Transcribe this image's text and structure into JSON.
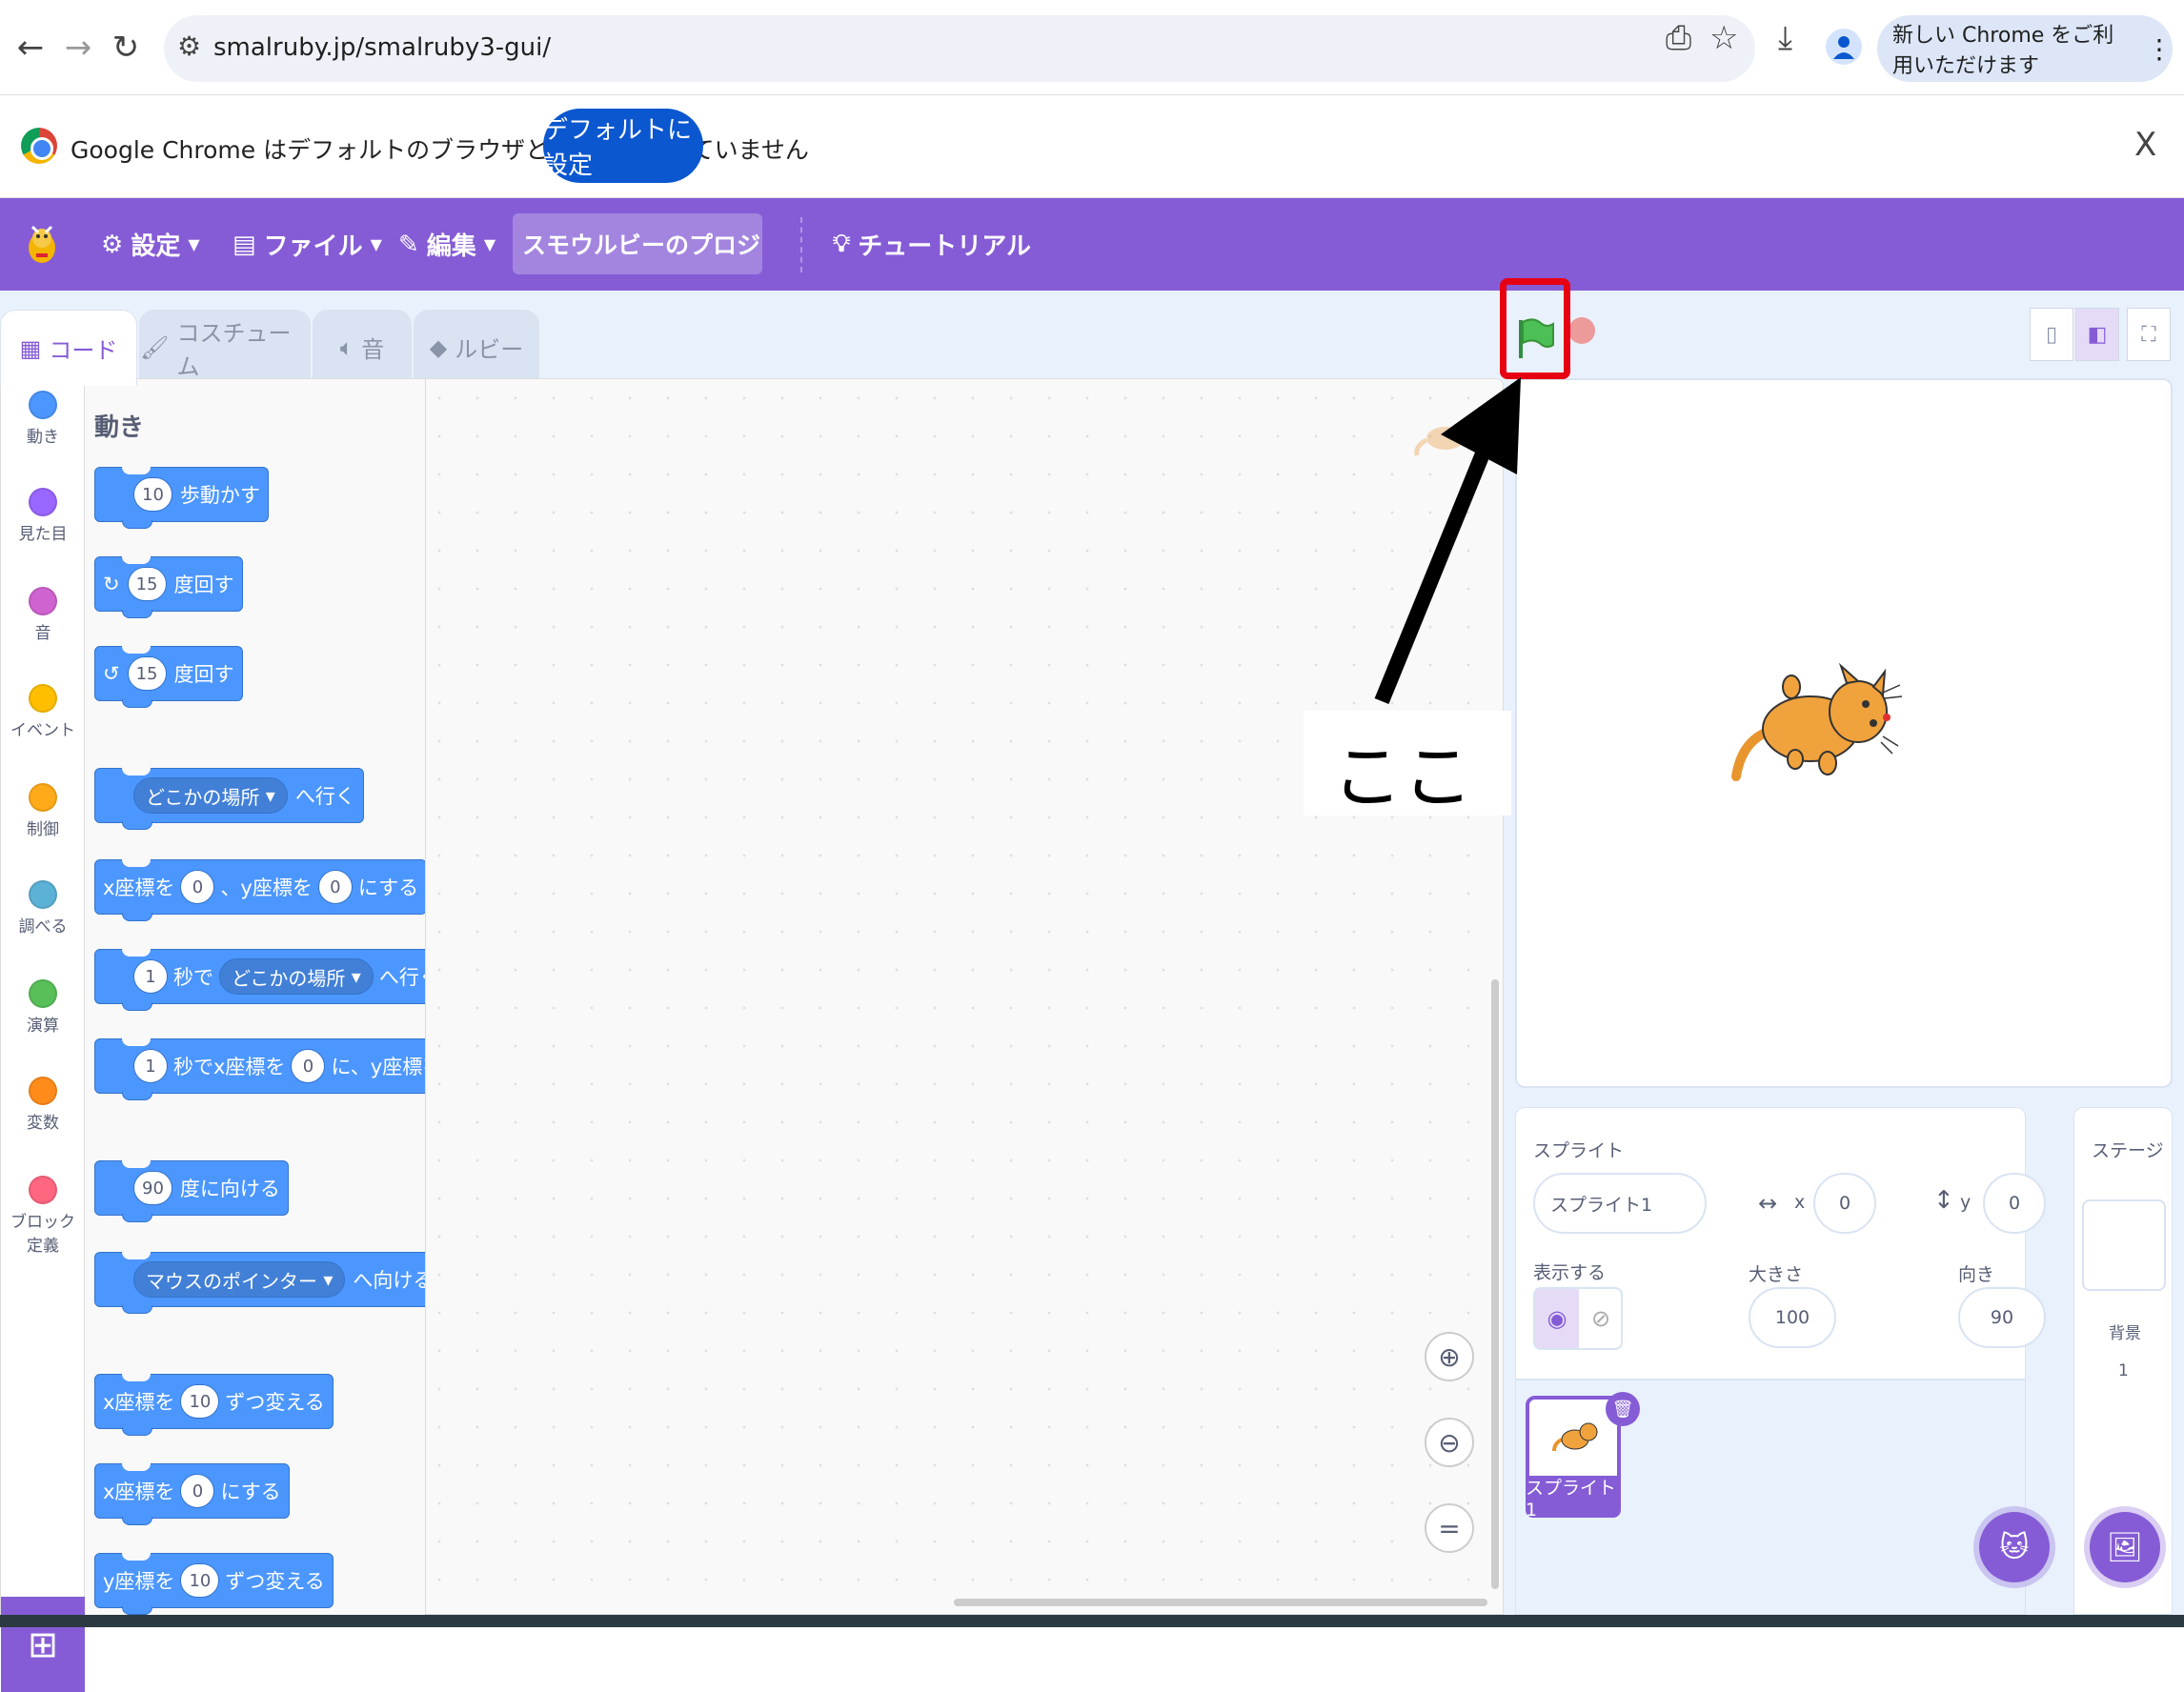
{
  "browser": {
    "url": "smalruby.jp/smalruby3-gui/",
    "new_chrome_text": "新しい Chrome をご利用いただけます",
    "infobar_message": "Google Chrome はデフォルトのブラウザとして設定されていません",
    "infobar_button": "デフォルトに設定",
    "infobar_close": "X"
  },
  "menubar": {
    "settings": "設定",
    "file": "ファイル",
    "edit": "編集",
    "project_title": "スモウルビーのプロジェ...",
    "tutorial": "チュートリアル"
  },
  "tabs": {
    "code": "コード",
    "costume": "コスチューム",
    "sound": "音",
    "ruby": "ルビー"
  },
  "categories": [
    {
      "label": "動き",
      "color": "#4c97ff"
    },
    {
      "label": "見た目",
      "color": "#9966ff"
    },
    {
      "label": "音",
      "color": "#cf63cf"
    },
    {
      "label": "イベント",
      "color": "#ffbf00"
    },
    {
      "label": "制御",
      "color": "#ffab19"
    },
    {
      "label": "調べる",
      "color": "#5cb1d6"
    },
    {
      "label": "演算",
      "color": "#59c059"
    },
    {
      "label": "変数",
      "color": "#ff8c1a"
    },
    {
      "label": "ブロック定義",
      "color": "#ff6680"
    }
  ],
  "flyout": {
    "title": "動き",
    "blocks": {
      "move": {
        "num": "10",
        "text": "歩動かす"
      },
      "turn_right": {
        "num": "15",
        "text": "度回す"
      },
      "turn_left": {
        "num": "15",
        "text": "度回す"
      },
      "goto": {
        "drop": "どこかの場所",
        "text": "へ行く"
      },
      "goto_xy": {
        "pre": "x座標を",
        "x": "0",
        "mid": "、y座標を",
        "y": "0",
        "post": "にする"
      },
      "glide": {
        "num": "1",
        "mid": "秒で",
        "drop": "どこかの場所",
        "post": "へ行く"
      },
      "glide_xy": {
        "num": "1",
        "mid": "秒でx座標を",
        "x": "0",
        "post": "に、y座標を"
      },
      "point_dir": {
        "num": "90",
        "text": "度に向ける"
      },
      "point_towards": {
        "drop": "マウスのポインター",
        "text": "へ向ける"
      },
      "change_x": {
        "pre": "x座標を",
        "num": "10",
        "post": "ずつ変える"
      },
      "set_x": {
        "pre": "x座標を",
        "num": "0",
        "post": "にする"
      },
      "change_y": {
        "pre": "y座標を",
        "num": "10",
        "post": "ずつ変える"
      }
    }
  },
  "annotation": {
    "text": "ここ",
    "highlight_color": "#e60012"
  },
  "sprite_info": {
    "sprite_label": "スプライト",
    "sprite_name": "スプライト1",
    "x_label": "x",
    "x_value": "0",
    "y_label": "y",
    "y_value": "0",
    "show_label": "表示する",
    "size_label": "大きさ",
    "size_value": "100",
    "direction_label": "向き",
    "direction_value": "90"
  },
  "sprite_list": {
    "thumb_name": "スプライト1"
  },
  "stage_pane": {
    "title": "ステージ",
    "backdrop_label": "背景",
    "backdrop_count": "1"
  },
  "colors": {
    "accent": "#855cd6",
    "motion": "#4c97ff"
  }
}
